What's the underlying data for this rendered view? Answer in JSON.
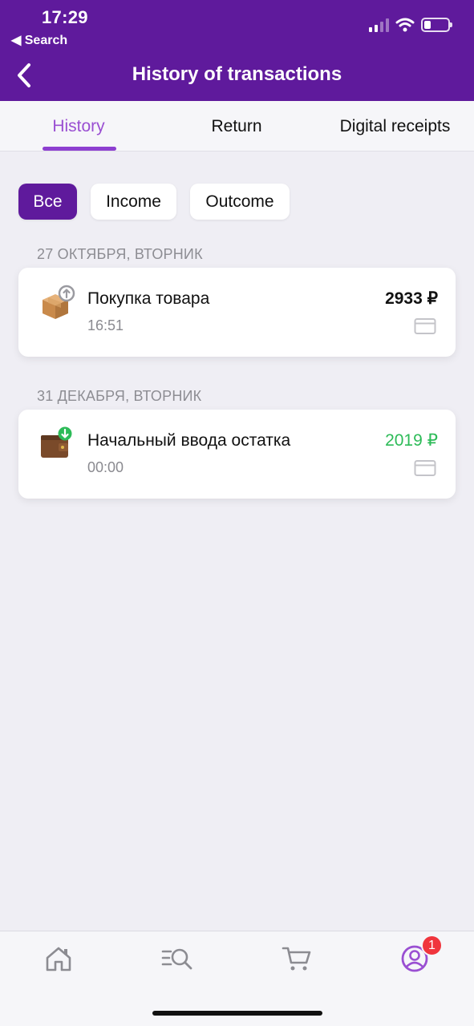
{
  "status_bar": {
    "time": "17:29",
    "back_label": "◀ Search"
  },
  "header": {
    "title": "History of transactions"
  },
  "tabs": [
    {
      "label": "History",
      "active": true
    },
    {
      "label": "Return",
      "active": false
    },
    {
      "label": "Digital receipts",
      "active": false
    }
  ],
  "filters": [
    {
      "label": "Все",
      "active": true
    },
    {
      "label": "Income",
      "active": false
    },
    {
      "label": "Outcome",
      "active": false
    }
  ],
  "groups": [
    {
      "date": "27 ОКТЯБРЯ, ВТОРНИК",
      "transactions": [
        {
          "title": "Покупка товара",
          "time": "16:51",
          "amount": "2933 ₽",
          "type": "outcome",
          "icon": "package-icon"
        }
      ]
    },
    {
      "date": "31 ДЕКАБРЯ, ВТОРНИК",
      "transactions": [
        {
          "title": "Начальный ввода остатка",
          "time": "00:00",
          "amount": "2019 ₽",
          "type": "income",
          "icon": "wallet-icon"
        }
      ]
    }
  ],
  "bottom_nav": {
    "items": [
      "home-icon",
      "catalog-search-icon",
      "cart-icon",
      "profile-icon"
    ],
    "badge": "1"
  },
  "colors": {
    "brand": "#5f1a9c",
    "accent": "#9a4fd2",
    "income": "#2dbb58",
    "badge": "#f0353d"
  }
}
